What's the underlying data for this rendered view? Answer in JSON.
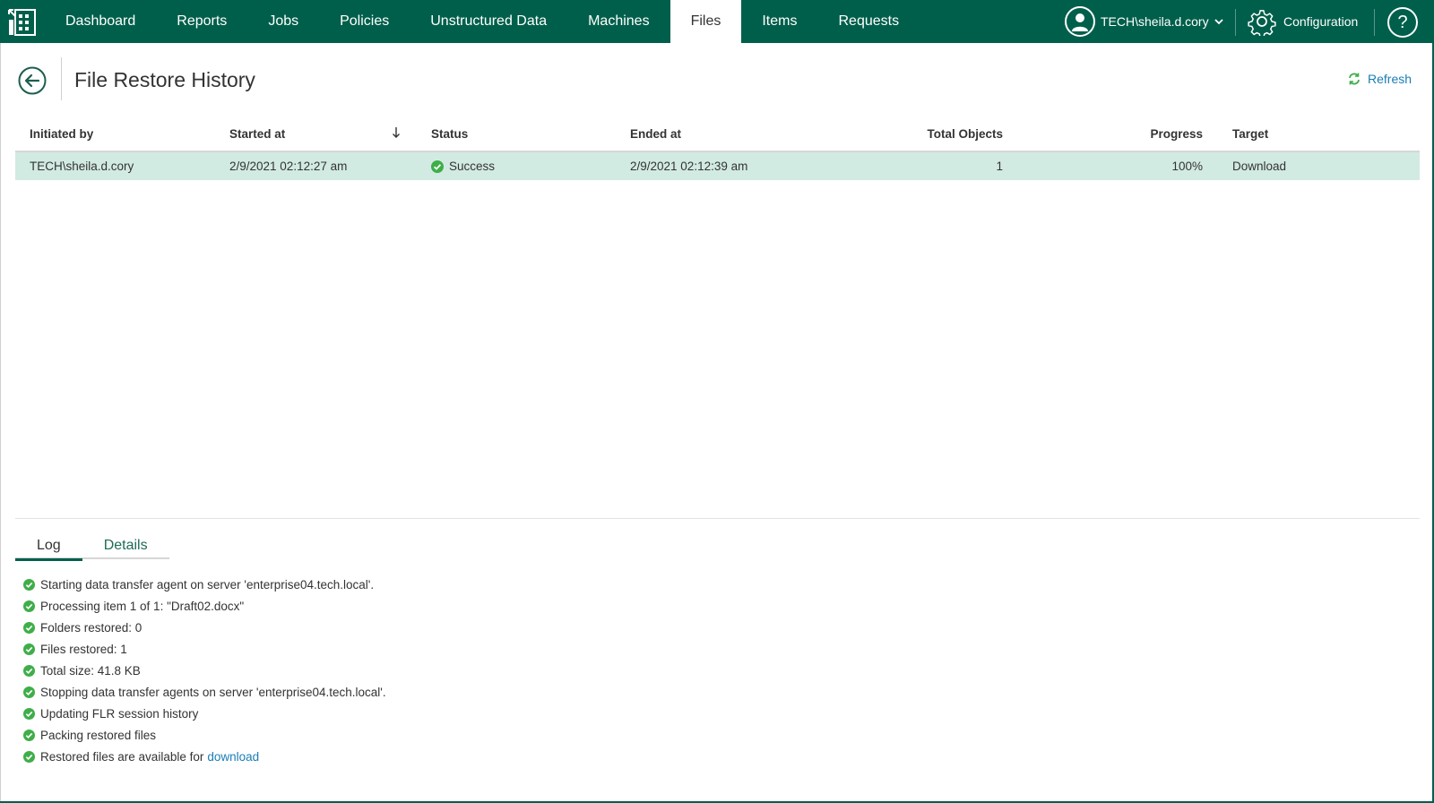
{
  "nav": {
    "items": [
      {
        "label": "Dashboard"
      },
      {
        "label": "Reports"
      },
      {
        "label": "Jobs"
      },
      {
        "label": "Policies"
      },
      {
        "label": "Unstructured Data"
      },
      {
        "label": "Machines"
      },
      {
        "label": "Files"
      },
      {
        "label": "Items"
      },
      {
        "label": "Requests"
      }
    ],
    "active": "Files",
    "user_label": "TECH\\sheila.d.cory",
    "config_label": "Configuration",
    "help_label": "?"
  },
  "header": {
    "title": "File Restore History",
    "refresh_label": "Refresh"
  },
  "grid": {
    "columns": {
      "initiated_by": "Initiated by",
      "started_at": "Started at",
      "status": "Status",
      "ended_at": "Ended at",
      "total_objects": "Total Objects",
      "progress": "Progress",
      "target": "Target"
    },
    "rows": [
      {
        "initiated_by": "TECH\\sheila.d.cory",
        "started_at": "2/9/2021 02:12:27 am",
        "status": "Success",
        "ended_at": "2/9/2021 02:12:39 am",
        "total_objects": "1",
        "progress": "100%",
        "target": "Download"
      }
    ]
  },
  "details_panel": {
    "tabs": [
      {
        "label": "Log"
      },
      {
        "label": "Details"
      }
    ],
    "active_tab": "Log",
    "log": [
      "Starting data transfer agent on server 'enterprise04.tech.local'.",
      "Processing item 1 of 1: \"Draft02.docx\"",
      "Folders restored: 0",
      "Files restored: 1",
      "Total size: 41.8 KB",
      "Stopping data transfer agents on server 'enterprise04.tech.local'.",
      "Updating FLR session history",
      "Packing restored files",
      "Restored files are available for"
    ],
    "download_link": "download"
  },
  "colors": {
    "brand": "#005f4b",
    "selected_row": "#d2ebe2",
    "success": "#3fae49",
    "link": "#1a7db6"
  }
}
